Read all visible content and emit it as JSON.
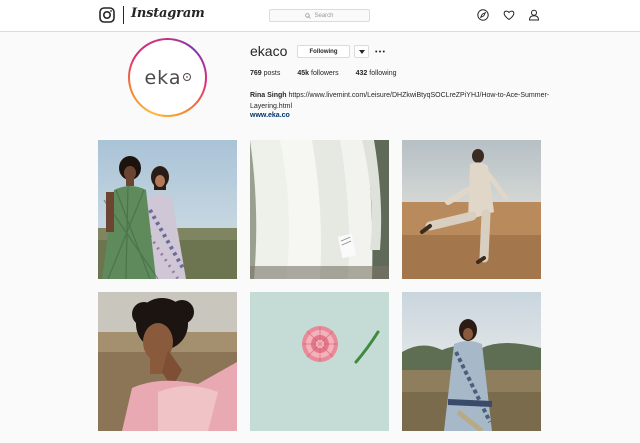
{
  "header": {
    "brand": "Instagram",
    "search_placeholder": "Search"
  },
  "icons": {
    "logo": "instagram-glyph-icon",
    "search": "search-icon",
    "explore": "compass-icon",
    "activity": "heart-icon",
    "profile": "person-icon"
  },
  "profile": {
    "username": "ekaco",
    "avatar_text": "eka",
    "follow_button": "Following",
    "posts_count": "769",
    "posts_label": "posts",
    "followers_count": "45k",
    "followers_label": "followers",
    "following_count": "432",
    "following_label": "following",
    "full_name": "Rina Singh",
    "bio": "https://www.livemint.com/Leisure/DHZkwiBtyqSOCLreZPiYHJ/How-to-Ace-Summer-Layering.html",
    "website": "www.eka.co"
  },
  "posts": [
    {
      "subject": "two women in green gingham and floral dresses"
    },
    {
      "subject": "white sheer curtains with a tag"
    },
    {
      "subject": "person in white kurta kicking in a field"
    },
    {
      "subject": "woman with curly hair and pink scarf"
    },
    {
      "subject": "pink flower and leaf on pale green background"
    },
    {
      "subject": "woman in printed layered outfit in a field"
    }
  ],
  "colors": {
    "link": "#003569",
    "border": "#dbdbdb",
    "background": "#fafafa"
  }
}
